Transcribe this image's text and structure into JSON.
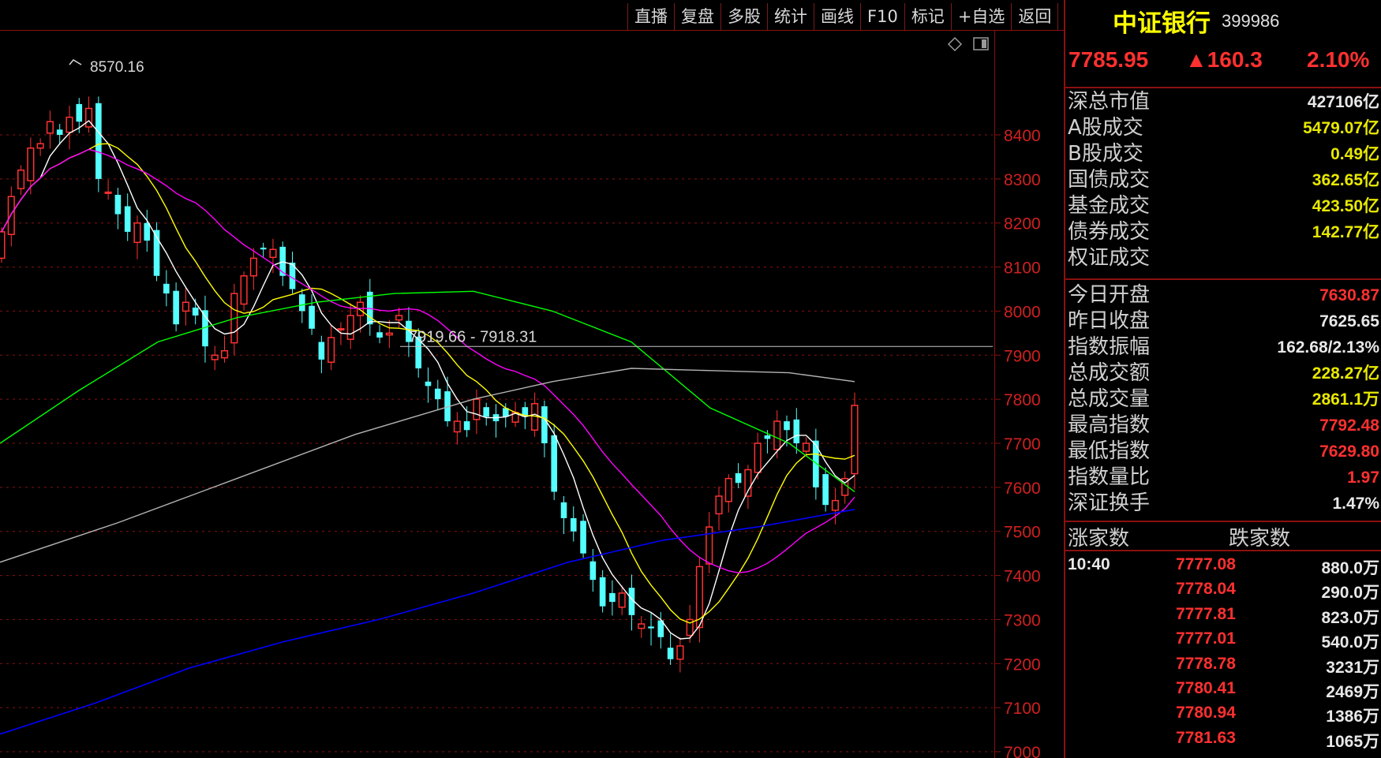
{
  "toolbar": {
    "buttons": [
      "直播",
      "复盘",
      "多股",
      "统计",
      "画线",
      "F10",
      "标记",
      "+自选",
      "返回"
    ]
  },
  "chart": {
    "high_label": "8570.16",
    "crosshair_label": "7919.66 - 7918.31",
    "price_axis": [
      "8400",
      "8300",
      "8200",
      "8100",
      "8000",
      "7900",
      "7800",
      "7700",
      "7600",
      "7500",
      "7400",
      "7300",
      "7200",
      "7100",
      "7000"
    ],
    "colors": {
      "up": "#ff3232",
      "down": "#54ffff",
      "ma5": "#ffffff",
      "ma10": "#ffff00",
      "ma20": "#ff00ff",
      "ma60": "#00ff00",
      "ma120": "#0000ff",
      "ma250": "#b4b4b4",
      "grid": "#8a1010"
    }
  },
  "quote": {
    "name": "中证银行",
    "code": "399986",
    "price": "7785.95",
    "change": "▲160.3",
    "change_pct": "2.10%"
  },
  "stats": [
    {
      "label": "深总市值",
      "value": "427106亿",
      "color": "#e8e8e8"
    },
    {
      "label": "A股成交",
      "value": "5479.07亿",
      "color": "#e8e800"
    },
    {
      "label": "B股成交",
      "value": "0.49亿",
      "color": "#e8e800"
    },
    {
      "label": "国债成交",
      "value": "362.65亿",
      "color": "#e8e800"
    },
    {
      "label": "基金成交",
      "value": "423.50亿",
      "color": "#e8e800"
    },
    {
      "label": "债券成交",
      "value": "142.77亿",
      "color": "#e8e800"
    },
    {
      "label": "权证成交",
      "value": "",
      "color": "#e8e800"
    },
    {
      "label": "今日开盘",
      "value": "7630.87",
      "color": "#ff3030"
    },
    {
      "label": "昨日收盘",
      "value": "7625.65",
      "color": "#e8e8e8"
    },
    {
      "label": "指数振幅",
      "value": "162.68/2.13%",
      "color": "#e8e8e8"
    },
    {
      "label": "总成交额",
      "value": "228.27亿",
      "color": "#e8e800"
    },
    {
      "label": "总成交量",
      "value": "2861.1万",
      "color": "#e8e800"
    },
    {
      "label": "最高指数",
      "value": "7792.48",
      "color": "#ff3030"
    },
    {
      "label": "最低指数",
      "value": "7629.80",
      "color": "#ff3030"
    },
    {
      "label": "指数量比",
      "value": "1.97",
      "color": "#ff3030"
    },
    {
      "label": "深证换手",
      "value": "1.47%",
      "color": "#e8e8e8"
    }
  ],
  "breadth": {
    "up_label": "涨家数",
    "down_label": "跌家数"
  },
  "ticks": {
    "time": "10:40",
    "rows": [
      {
        "price": "7777.08",
        "vol": "880.0万"
      },
      {
        "price": "7778.04",
        "vol": "290.0万"
      },
      {
        "price": "7777.81",
        "vol": "823.0万"
      },
      {
        "price": "7777.01",
        "vol": "540.0万"
      },
      {
        "price": "7778.78",
        "vol": "3231万"
      },
      {
        "price": "7780.41",
        "vol": "2469万"
      },
      {
        "price": "7780.94",
        "vol": "1386万"
      },
      {
        "price": "7781.63",
        "vol": "1065万"
      }
    ]
  }
}
